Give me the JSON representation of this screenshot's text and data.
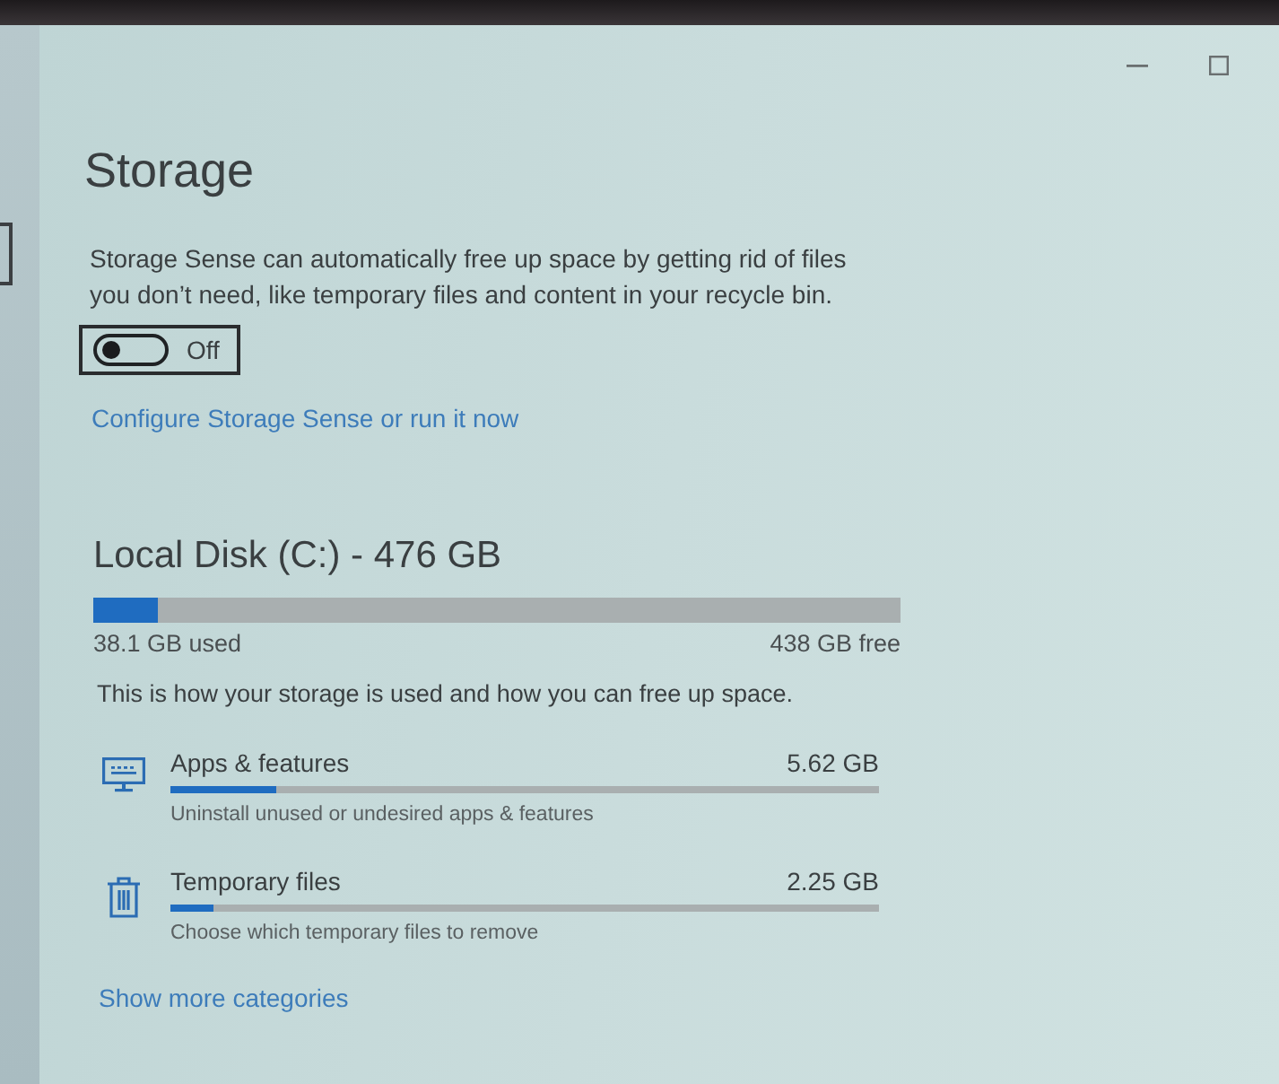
{
  "page": {
    "title": "Storage"
  },
  "storage_sense": {
    "description": "Storage Sense can automatically free up space by getting rid of files you don’t need, like temporary files and content in your recycle bin.",
    "toggle": {
      "on": false,
      "label": "Off"
    },
    "link": "Configure Storage Sense or run it now"
  },
  "disk": {
    "title": "Local Disk (C:) - 476 GB",
    "level": 0.08,
    "used": "38.1 GB used",
    "free": "438 GB free",
    "note": "This is how your storage is used and how you can free up space."
  },
  "categories": [
    {
      "kind": "apps",
      "name": "Apps & features",
      "size": "5.62 GB",
      "level": 0.15,
      "description": "Uninstall unused or undesired apps & features"
    },
    {
      "kind": "temp",
      "name": "Temporary files",
      "size": "2.25 GB",
      "level": 0.06,
      "description": "Choose which temporary files to remove"
    }
  ],
  "show_more": "Show more categories"
}
